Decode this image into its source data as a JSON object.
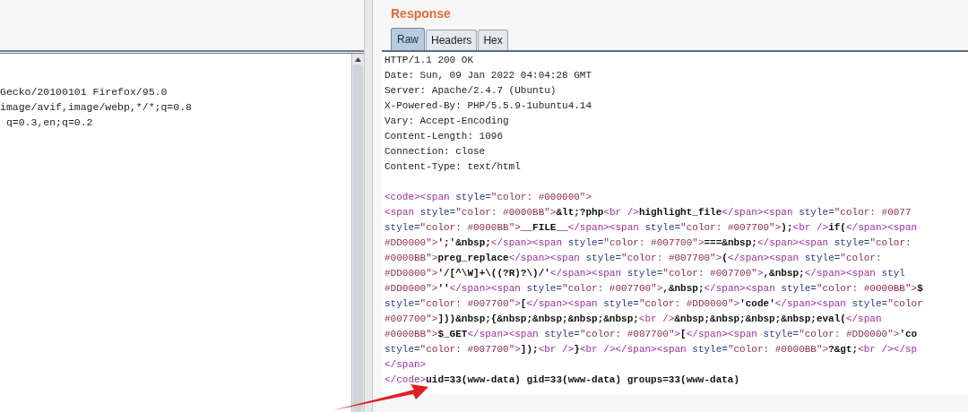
{
  "request": {
    "lines": [
      "Gecko/20100101 Firefox/95.0",
      "image/avif,image/webp,*/*;q=0.8",
      " q=0.3,en;q=0.2"
    ]
  },
  "response": {
    "title": "Response",
    "tabs": [
      {
        "label": "Raw",
        "selected": true
      },
      {
        "label": "Headers",
        "selected": false
      },
      {
        "label": "Hex",
        "selected": false
      }
    ],
    "headers": [
      "HTTP/1.1 200 OK",
      "Date: Sun, 09 Jan 2022 04:04:28 GMT",
      "Server: Apache/2.4.7 (Ubuntu)",
      "X-Powered-By: PHP/5.5.9-1ubuntu4.14",
      "Vary: Accept-Encoding",
      "Content-Length: 1096",
      "Connection: close",
      "Content-Type: text/html"
    ],
    "body": [
      [
        {
          "kind": "tag",
          "text": "<code><span"
        },
        {
          "kind": "attr",
          "text": " style="
        },
        {
          "kind": "value",
          "text": "\"color: #000000\""
        },
        {
          "kind": "tag",
          "text": ">"
        }
      ],
      [
        {
          "kind": "tag",
          "text": "<span"
        },
        {
          "kind": "attr",
          "text": " style="
        },
        {
          "kind": "value",
          "text": "\"color: #0000BB\""
        },
        {
          "kind": "tag",
          "text": ">"
        },
        {
          "kind": "text",
          "text": "&lt;?php"
        },
        {
          "kind": "tag",
          "text": "<br />"
        },
        {
          "kind": "text",
          "text": "highlight_file"
        },
        {
          "kind": "tag",
          "text": "</span><span"
        },
        {
          "kind": "attr",
          "text": " style="
        },
        {
          "kind": "value",
          "text": "\"color: #0077"
        }
      ],
      [
        {
          "kind": "attr",
          "text": "style="
        },
        {
          "kind": "value",
          "text": "\"color: #0000BB\""
        },
        {
          "kind": "tag",
          "text": ">"
        },
        {
          "kind": "text",
          "text": "__FILE__"
        },
        {
          "kind": "tag",
          "text": "</span><span"
        },
        {
          "kind": "attr",
          "text": " style="
        },
        {
          "kind": "value",
          "text": "\"color: #007700\""
        },
        {
          "kind": "tag",
          "text": ">"
        },
        {
          "kind": "text",
          "text": ");"
        },
        {
          "kind": "tag",
          "text": "<br />"
        },
        {
          "kind": "text",
          "text": "if("
        },
        {
          "kind": "tag",
          "text": "</span><span"
        }
      ],
      [
        {
          "kind": "value",
          "text": "#DD0000\""
        },
        {
          "kind": "tag",
          "text": ">"
        },
        {
          "kind": "text",
          "text": "';'&nbsp;"
        },
        {
          "kind": "tag",
          "text": "</span><span"
        },
        {
          "kind": "attr",
          "text": " style="
        },
        {
          "kind": "value",
          "text": "\"color: #007700\""
        },
        {
          "kind": "tag",
          "text": ">"
        },
        {
          "kind": "text",
          "text": "===&nbsp;"
        },
        {
          "kind": "tag",
          "text": "</span><span"
        },
        {
          "kind": "attr",
          "text": " style="
        },
        {
          "kind": "value",
          "text": "\"color:"
        }
      ],
      [
        {
          "kind": "value",
          "text": "#0000BB\""
        },
        {
          "kind": "tag",
          "text": ">"
        },
        {
          "kind": "text",
          "text": "preg_replace"
        },
        {
          "kind": "tag",
          "text": "</span><span"
        },
        {
          "kind": "attr",
          "text": " style="
        },
        {
          "kind": "value",
          "text": "\"color: #007700\""
        },
        {
          "kind": "tag",
          "text": ">"
        },
        {
          "kind": "text",
          "text": "("
        },
        {
          "kind": "tag",
          "text": "</span><span"
        },
        {
          "kind": "attr",
          "text": " style="
        },
        {
          "kind": "value",
          "text": "\"color:"
        }
      ],
      [
        {
          "kind": "value",
          "text": "#DD0000\""
        },
        {
          "kind": "tag",
          "text": ">"
        },
        {
          "kind": "text",
          "text": "'/[^\\W]+\\((?R)?\\)/'"
        },
        {
          "kind": "tag",
          "text": "</span><span"
        },
        {
          "kind": "attr",
          "text": " style="
        },
        {
          "kind": "value",
          "text": "\"color: #007700\""
        },
        {
          "kind": "tag",
          "text": ">"
        },
        {
          "kind": "text",
          "text": ",&nbsp;"
        },
        {
          "kind": "tag",
          "text": "</span><span"
        },
        {
          "kind": "attr",
          "text": " styl"
        }
      ],
      [
        {
          "kind": "value",
          "text": "#DD0000\""
        },
        {
          "kind": "tag",
          "text": ">"
        },
        {
          "kind": "text",
          "text": "''"
        },
        {
          "kind": "tag",
          "text": "</span><span"
        },
        {
          "kind": "attr",
          "text": " style="
        },
        {
          "kind": "value",
          "text": "\"color: #007700\""
        },
        {
          "kind": "tag",
          "text": ">"
        },
        {
          "kind": "text",
          "text": ",&nbsp;"
        },
        {
          "kind": "tag",
          "text": "</span><span"
        },
        {
          "kind": "attr",
          "text": " style="
        },
        {
          "kind": "value",
          "text": "\"color: #0000BB\""
        },
        {
          "kind": "tag",
          "text": ">"
        },
        {
          "kind": "text",
          "text": "$"
        }
      ],
      [
        {
          "kind": "attr",
          "text": "style="
        },
        {
          "kind": "value",
          "text": "\"color: #007700\""
        },
        {
          "kind": "tag",
          "text": ">"
        },
        {
          "kind": "text",
          "text": "["
        },
        {
          "kind": "tag",
          "text": "</span><span"
        },
        {
          "kind": "attr",
          "text": " style="
        },
        {
          "kind": "value",
          "text": "\"color: #DD0000\""
        },
        {
          "kind": "tag",
          "text": ">"
        },
        {
          "kind": "text",
          "text": "'code'"
        },
        {
          "kind": "tag",
          "text": "</span><span"
        },
        {
          "kind": "attr",
          "text": " style="
        },
        {
          "kind": "value",
          "text": "\"color"
        }
      ],
      [
        {
          "kind": "value",
          "text": "#007700\""
        },
        {
          "kind": "tag",
          "text": ">"
        },
        {
          "kind": "text",
          "text": "]))&nbsp;{&nbsp;&nbsp;&nbsp;&nbsp;"
        },
        {
          "kind": "tag",
          "text": "<br />"
        },
        {
          "kind": "text",
          "text": "&nbsp;&nbsp;&nbsp;&nbsp;eval("
        },
        {
          "kind": "tag",
          "text": "</span"
        }
      ],
      [
        {
          "kind": "value",
          "text": "#0000BB\""
        },
        {
          "kind": "tag",
          "text": ">"
        },
        {
          "kind": "text",
          "text": "$_GET"
        },
        {
          "kind": "tag",
          "text": "</span><span"
        },
        {
          "kind": "attr",
          "text": " style="
        },
        {
          "kind": "value",
          "text": "\"color: #007700\""
        },
        {
          "kind": "tag",
          "text": ">"
        },
        {
          "kind": "text",
          "text": "["
        },
        {
          "kind": "tag",
          "text": "</span><span"
        },
        {
          "kind": "attr",
          "text": " style="
        },
        {
          "kind": "value",
          "text": "\"color: #DD0000\""
        },
        {
          "kind": "tag",
          "text": ">"
        },
        {
          "kind": "text",
          "text": "'co"
        }
      ],
      [
        {
          "kind": "attr",
          "text": "style="
        },
        {
          "kind": "value",
          "text": "\"color: #007700\""
        },
        {
          "kind": "tag",
          "text": ">"
        },
        {
          "kind": "text",
          "text": "]);"
        },
        {
          "kind": "tag",
          "text": "<br />"
        },
        {
          "kind": "text",
          "text": "}"
        },
        {
          "kind": "tag",
          "text": "<br /></span><span"
        },
        {
          "kind": "attr",
          "text": " style="
        },
        {
          "kind": "value",
          "text": "\"color: #0000BB\""
        },
        {
          "kind": "tag",
          "text": ">"
        },
        {
          "kind": "text",
          "text": "?&gt;"
        },
        {
          "kind": "tag",
          "text": "<br /></sp"
        }
      ],
      [
        {
          "kind": "tag",
          "text": "</span>"
        }
      ],
      [
        {
          "kind": "tag",
          "text": "</code>"
        },
        {
          "kind": "text",
          "text": "uid=33(www-data) gid=33(www-data) groups=33(www-data)"
        }
      ]
    ]
  }
}
